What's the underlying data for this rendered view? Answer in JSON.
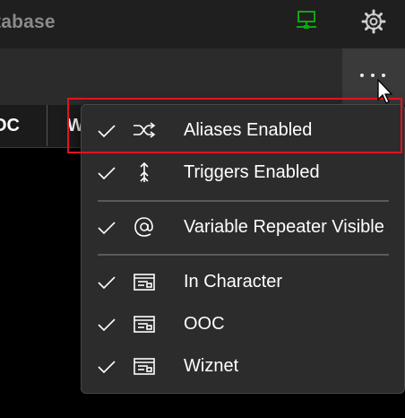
{
  "app": {
    "title": "tabase"
  },
  "toolbar": {
    "more_icon": "more-horizontal-icon"
  },
  "tabs": [
    {
      "label": "OC"
    },
    {
      "label": "W"
    }
  ],
  "menu": {
    "items": [
      {
        "label": "Aliases Enabled",
        "checked": true,
        "icon": "shuffle-icon"
      },
      {
        "label": "Triggers Enabled",
        "checked": true,
        "icon": "trigger-arrow-icon"
      },
      {
        "label": "Variable Repeater Visible",
        "checked": true,
        "icon": "at-sign-icon"
      },
      {
        "label": "In Character",
        "checked": true,
        "icon": "terminal-window-icon"
      },
      {
        "label": "OOC",
        "checked": true,
        "icon": "terminal-window-icon"
      },
      {
        "label": "Wiznet",
        "checked": true,
        "icon": "terminal-window-icon"
      }
    ]
  },
  "colors": {
    "highlight": "#e0141e",
    "network_status": "#12a512"
  }
}
